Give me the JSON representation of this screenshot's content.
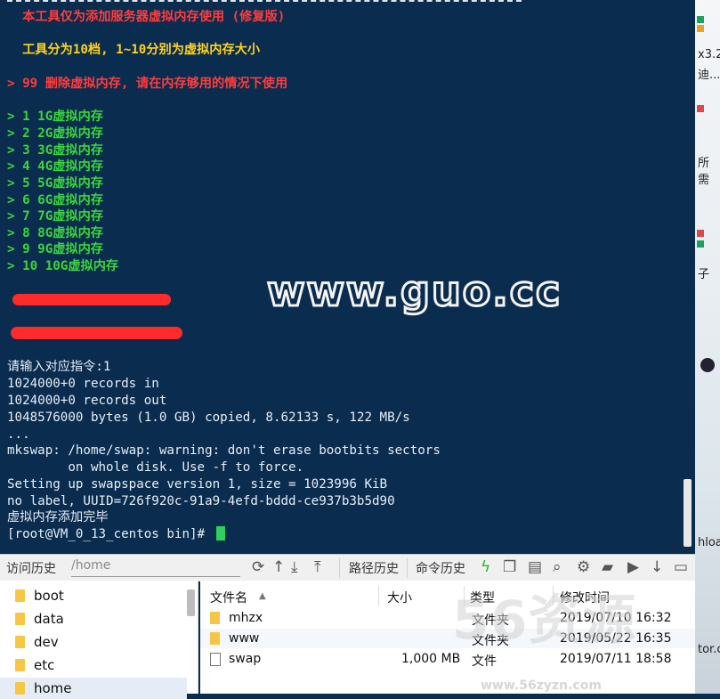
{
  "terminal": {
    "lines": [
      {
        "text": "  本工具仅为添加服务器虚拟内存使用 (修复版)",
        "color": "red"
      },
      {
        "text": "  工具分为10档, 1~10分别为虚拟内存大小",
        "color": "yellow"
      },
      {
        "text": "> 99 删除虚拟内存, 请在内存够用的情况下使用",
        "color": "red"
      },
      {
        "text": "> 1 1G虚拟内存",
        "color": "green"
      },
      {
        "text": "> 2 2G虚拟内存",
        "color": "green"
      },
      {
        "text": "> 3 3G虚拟内存",
        "color": "green"
      },
      {
        "text": "> 4 4G虚拟内存",
        "color": "green"
      },
      {
        "text": "> 5 5G虚拟内存",
        "color": "green"
      },
      {
        "text": "> 6 6G虚拟内存",
        "color": "green"
      },
      {
        "text": "> 7 7G虚拟内存",
        "color": "green"
      },
      {
        "text": "> 8 8G虚拟内存",
        "color": "green"
      },
      {
        "text": "> 9 9G虚拟内存",
        "color": "green"
      },
      {
        "text": "> 10 10G虚拟内存",
        "color": "green"
      },
      {
        "text": "请输入对应指令:1",
        "color": "white"
      },
      {
        "text": "1024000+0 records in",
        "color": "white"
      },
      {
        "text": "1024000+0 records out",
        "color": "white"
      },
      {
        "text": "1048576000 bytes (1.0 GB) copied, 8.62133 s, 122 MB/s",
        "color": "white"
      },
      {
        "text": "...",
        "color": "white"
      },
      {
        "text": "mkswap: /home/swap: warning: don't erase bootbits sectors",
        "color": "white"
      },
      {
        "text": "        on whole disk. Use -f to force.",
        "color": "white"
      },
      {
        "text": "Setting up swapspace version 1, size = 1023996 KiB",
        "color": "white"
      },
      {
        "text": "no label, UUID=726f920c-91a9-4efd-bddd-ce937b3b5d90",
        "color": "white"
      },
      {
        "text": "虚拟内存添加完毕",
        "color": "white"
      },
      {
        "text": "[root@VM_0_13_centos bin]# ",
        "color": "white"
      }
    ],
    "watermark": "www.guo.cc",
    "colors": {
      "background": "#0a2c4f",
      "red": "#ff3d3d",
      "yellow": "#ffd21f",
      "green": "#3bd63b",
      "cursor": "#2bd15a"
    }
  },
  "right_strip": {
    "texts": [
      "x3.2",
      "迪...",
      "所需",
      "子",
      "hloa",
      "tor.c"
    ]
  },
  "toolbar": {
    "history_tab": "访问历史",
    "path_placeholder": "/home",
    "path_history": "路径历史",
    "command_history": "命令历史",
    "icons": [
      "refresh-icon",
      "up-icon",
      "download-icon",
      "upload-icon",
      "lightning-icon",
      "copy-icon",
      "paste-icon",
      "search-icon",
      "gear-icon",
      "folder-icon",
      "play-icon",
      "down-arrow-icon",
      "window-icon"
    ]
  },
  "tree": {
    "items": [
      "boot",
      "data",
      "dev",
      "etc",
      "home"
    ],
    "selected": "home"
  },
  "files": {
    "headers": {
      "name": "文件名",
      "size": "大小",
      "type": "类型",
      "modified": "修改时间"
    },
    "rows": [
      {
        "name": "mhzx",
        "size": "",
        "type": "文件夹",
        "modified": "2019/07/10 16:32",
        "kind": "folder"
      },
      {
        "name": "www",
        "size": "",
        "type": "文件夹",
        "modified": "2019/05/22 16:35",
        "kind": "folder"
      },
      {
        "name": "swap",
        "size": "1,000 MB",
        "type": "文件",
        "modified": "2019/07/11 18:58",
        "kind": "file"
      }
    ],
    "watermark": "56资源",
    "watermark_url": "www.56zyzn.com"
  }
}
